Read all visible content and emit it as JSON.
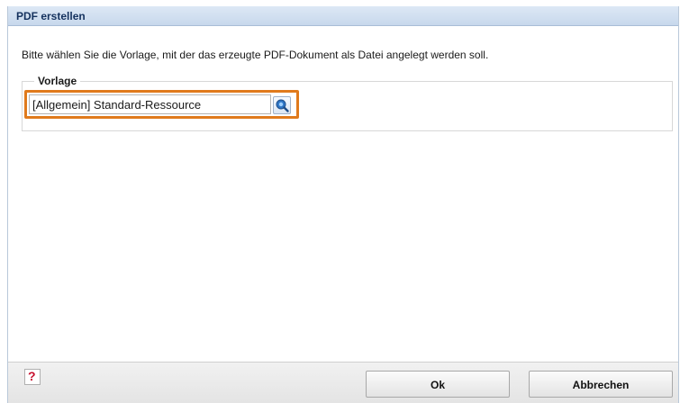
{
  "dialog": {
    "title": "PDF erstellen"
  },
  "content": {
    "instruction": "Bitte wählen Sie die Vorlage, mit der das erzeugte PDF-Dokument als Datei angelegt werden soll.",
    "template_group": {
      "legend": "Vorlage",
      "selected_value": "[Allgemein] Standard-Ressource",
      "lookup_icon": "search-icon"
    }
  },
  "footer": {
    "help_icon": "help-icon",
    "help_glyph": "?",
    "ok_label": "Ok",
    "cancel_label": "Abbrechen"
  },
  "colors": {
    "titlebar": "#c7d8ec",
    "title_text": "#15325e",
    "highlight": "#e07a1c",
    "help_glyph": "#c8102e"
  }
}
